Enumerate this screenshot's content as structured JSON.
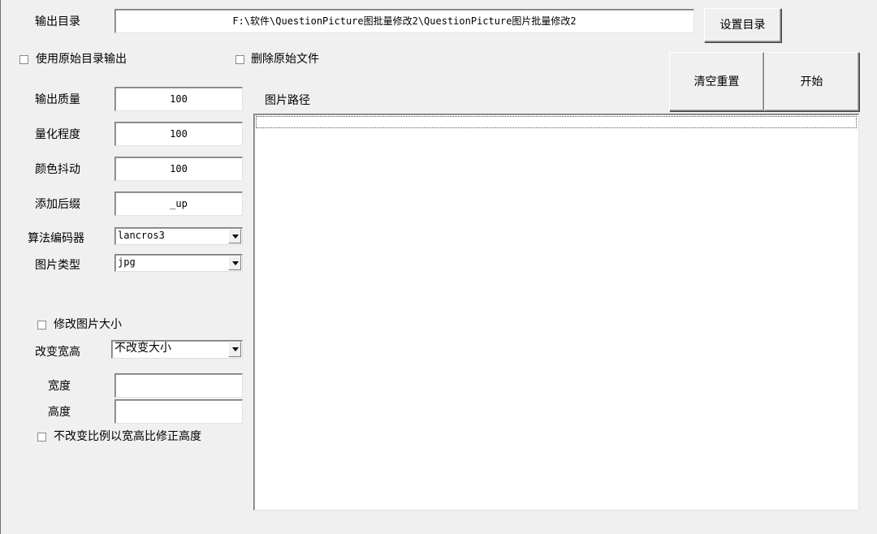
{
  "output_dir": {
    "label": "输出目录",
    "value": "F:\\软件\\QuestionPicture图批量修改2\\QuestionPicture图片批量修改2",
    "set_button": "设置目录"
  },
  "options": {
    "use_original_dir": "使用原始目录输出",
    "delete_original": "删除原始文件"
  },
  "actions": {
    "reset": "清空重置",
    "start": "开始"
  },
  "settings": {
    "quality_label": "输出质量",
    "quality_value": "100",
    "quantize_label": "量化程度",
    "quantize_value": "100",
    "dither_label": "颜色抖动",
    "dither_value": "100",
    "suffix_label": "添加后缀",
    "suffix_value": "_up",
    "codec_label": "算法编码器",
    "codec_value": "lancros3",
    "type_label": "图片类型",
    "type_value": "jpg"
  },
  "resize": {
    "modify_size": "修改图片大小",
    "mode_label": "改变宽高",
    "mode_value": "不改变大小",
    "width_label": "宽度",
    "width_value": "",
    "height_label": "高度",
    "height_value": "",
    "keep_ratio": "不改变比例以宽高比修正高度"
  },
  "list": {
    "header": "图片路径"
  }
}
